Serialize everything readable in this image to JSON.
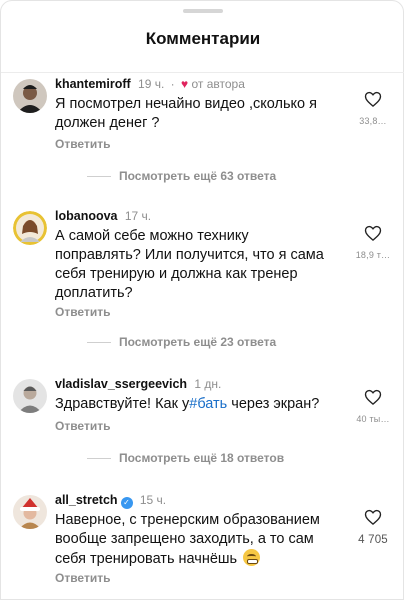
{
  "header": {
    "title": "Комментарии"
  },
  "comments": [
    {
      "username": "khantemiroff",
      "time": "19 ч.",
      "badge": "от автора",
      "text_lines": [
        "Я посмотрел нечайно видео ,сколько я",
        "должен денег ?"
      ],
      "reply_label": "Ответить",
      "likes": "33,8…",
      "more_replies": "Посмотреть ещё 63 ответа",
      "avatar_icon": "avatar-man-dark"
    },
    {
      "username": "lobanoova",
      "time": "17 ч.",
      "text_lines": [
        "А самой себе можно технику",
        "поправлять? Или получится, что я сама",
        "себя тренирую и должна как тренер",
        "доплатить?"
      ],
      "reply_label": "Ответить",
      "likes": "18,9 т…",
      "more_replies": "Посмотреть ещё 23 ответа",
      "avatar_icon": "avatar-woman-yellow-ring"
    },
    {
      "username": "vladislav_ssergeevich",
      "time": "1 дн.",
      "text_before": "Здравствуйте! Как у",
      "text_hashtag": "#бать",
      "text_after": " через экран?",
      "reply_label": "Ответить",
      "likes": "40 ты…",
      "more_replies": "Посмотреть ещё 18 ответов",
      "avatar_icon": "avatar-man-gray"
    },
    {
      "username": "all_stretch",
      "verified_icon": "verified-badge-icon",
      "time": "15 ч.",
      "text_lines": [
        "Наверное, с тренерским образованием",
        "вообще запрещено заходить, а то сам",
        "себя тренировать начнёшь"
      ],
      "emoji_icon": "grinning-face-emoji",
      "reply_label": "Ответить",
      "likes": "4 705",
      "avatar_icon": "avatar-woman-santa-hat"
    }
  ],
  "colors": {
    "accent_link": "#1a6fc9",
    "heart": "#e0245e",
    "muted": "#8e8e8e"
  }
}
